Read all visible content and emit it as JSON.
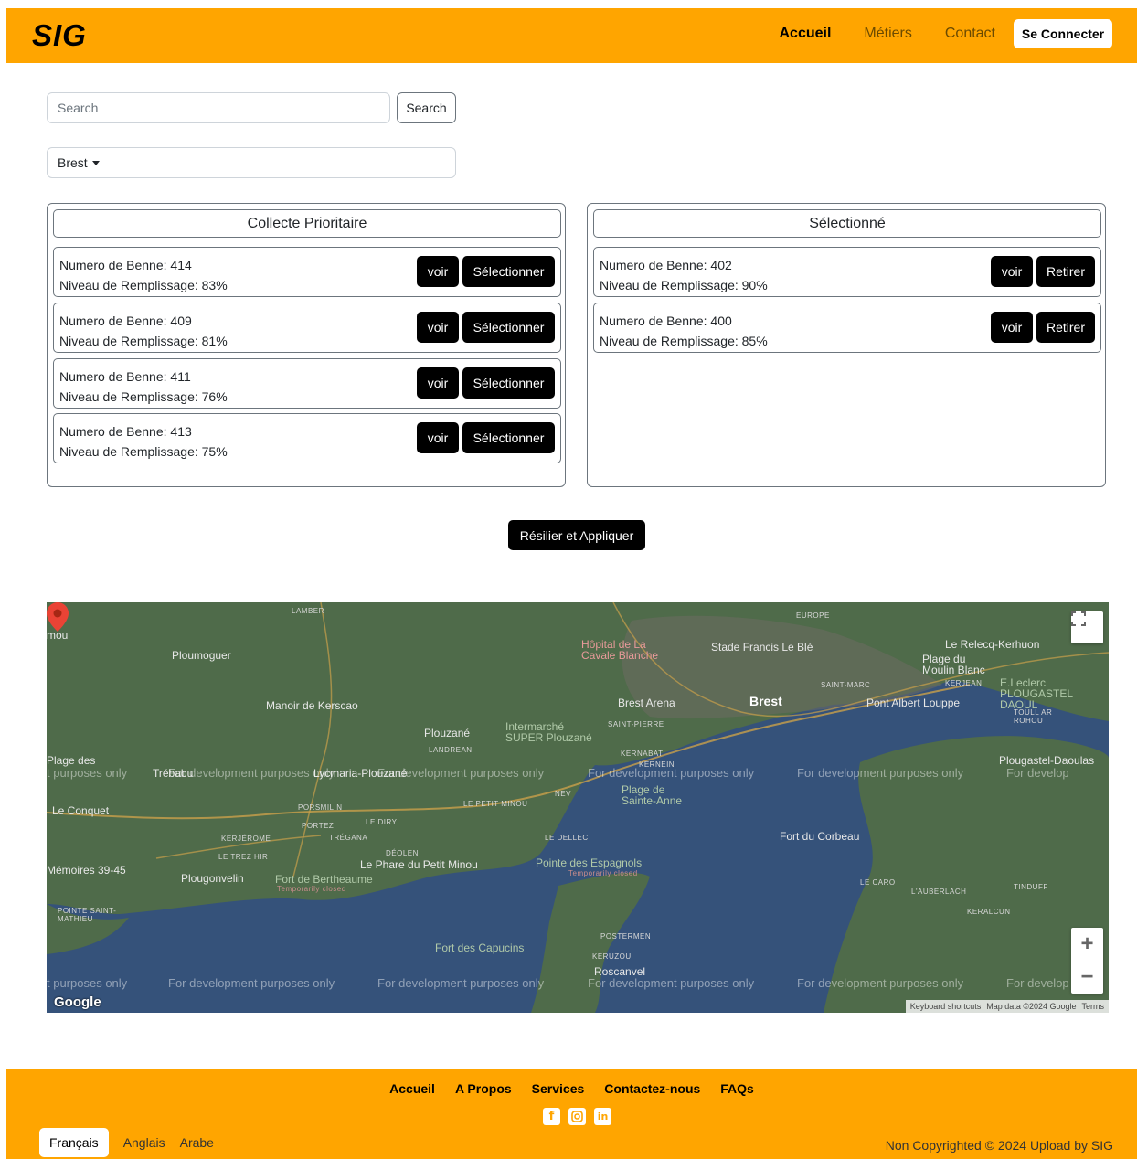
{
  "header": {
    "brand": "SIG",
    "nav": [
      "Accueil",
      "Métiers",
      "Contact"
    ],
    "login_label": "Se Connecter"
  },
  "search": {
    "placeholder": "Search",
    "button_label": "Search"
  },
  "city_select": {
    "value": "Brest"
  },
  "priority": {
    "title": "Collecte Prioritaire",
    "items": [
      {
        "numero": "Numero de Benne: 414",
        "niveau": "Niveau de Remplissage: 83%"
      },
      {
        "numero": "Numero de Benne: 409",
        "niveau": "Niveau de Remplissage: 81%"
      },
      {
        "numero": "Numero de Benne: 411",
        "niveau": "Niveau de Remplissage: 76%"
      },
      {
        "numero": "Numero de Benne: 413",
        "niveau": "Niveau de Remplissage: 75%"
      }
    ],
    "view_label": "voir",
    "select_label": "Sélectionner"
  },
  "selected": {
    "title": "Sélectionné",
    "items": [
      {
        "numero": "Numero de Benne: 402",
        "niveau": "Niveau de Remplissage: 90%"
      },
      {
        "numero": "Numero de Benne: 400",
        "niveau": "Niveau de Remplissage: 85%"
      }
    ],
    "view_label": "voir",
    "remove_label": "Retirer"
  },
  "apply_label": "Résilier et Appliquer",
  "map": {
    "labels": {
      "brest": "Brest",
      "ploumoguer": "Ploumoguer",
      "plouzane": "Plouzané",
      "manoir": "Manoir de Kerscao",
      "hopital": "Hôpital de La Cavale Blanche",
      "stade": "Stade Francis Le Blé",
      "relecq": "Le Relecq-Kerhuon",
      "plage_moulin": "Plage du Moulin Blanc",
      "arena": "Brest Arena",
      "pont_albert": "Pont Albert Louppe",
      "leclerc": "E.Leclerc PLOUGASTEL DAOUL",
      "intermarche": "Intermarché SUPER Plouzané",
      "plougastel": "Plougastel-Daoulas",
      "trebabu": "Trébabu",
      "plage_sainte_anne": "Plage de Sainte-Anne",
      "le_conquet": "Le Conquet",
      "fort_corbeau": "Fort du Corbeau",
      "memoires": "Mémoires 39-45",
      "plougonvelin": "Plougonvelin",
      "fort_bertheaume": "Fort de Bertheaume",
      "temp_closed": "Temporarily closed",
      "phare": "Le Phare du Petit Minou",
      "pointe_espagnols": "Pointe des Espagnols",
      "fort_capucins": "Fort des Capucins",
      "roscanvel": "Roscanvel",
      "lambder": "LAMBER",
      "landrean": "LANDREAN",
      "porsmilin": "PORSMILIN",
      "portez": "PORTEZ",
      "le_dirv": "LE DIRY",
      "kerjerome": "KERJÉROME",
      "tregana": "TRÉGANA",
      "deolen": "DÉOLEN",
      "le_trez_hir": "LE TREZ HIR",
      "le_petit_minou": "LE PETIT MINOU",
      "le_dellec": "LE DELLEC",
      "kernabat": "KERNABAT",
      "kernein": "KERNEIN",
      "saint_pierre": "SAINT-PIERRE",
      "saint_marc": "SAINT-MARC",
      "europe": "EUROPE",
      "kerjean": "KERJEAN",
      "toull_ar_rohou": "TOULL AR ROHOU",
      "le_caro": "LE CARO",
      "l_auberlach": "L'AUBERLACH",
      "tinduff": "TINDUFF",
      "keralcun": "KERALCUN",
      "postermen": "POSTERMEN",
      "kerizou": "KERUZOU",
      "pointe_saint_mathieu": "POINTE SAINT-MATHIEU",
      "plage_des": "Plage des",
      "mou": "mou",
      "lycmaria": "Lycmaria-Plouzané",
      "nev": "NEV"
    },
    "watermark": "For development purposes only",
    "watermark_partial_left": "t purposes only",
    "watermark_partial_right": "For develop",
    "logo": "Google",
    "attribution": [
      "Keyboard shortcuts",
      "Map data ©2024 Google",
      "Terms"
    ],
    "fullscreen_icon": "fullscreen-icon",
    "zoom_in": "+",
    "zoom_out": "−"
  },
  "footer": {
    "links": [
      "Accueil",
      "A Propos",
      "Services",
      "Contactez-nous",
      "FAQs"
    ],
    "socials": [
      "facebook-icon",
      "instagram-icon",
      "linkedin-icon"
    ],
    "languages": [
      "Français",
      "Anglais",
      "Arabe"
    ],
    "copyright": "Non Copyrighted © 2024 Upload by SIG"
  },
  "colors": {
    "brand": "#FFA500",
    "dark_button": "#000000",
    "map_water": "#35527a",
    "map_land": "#4f6b4a"
  }
}
